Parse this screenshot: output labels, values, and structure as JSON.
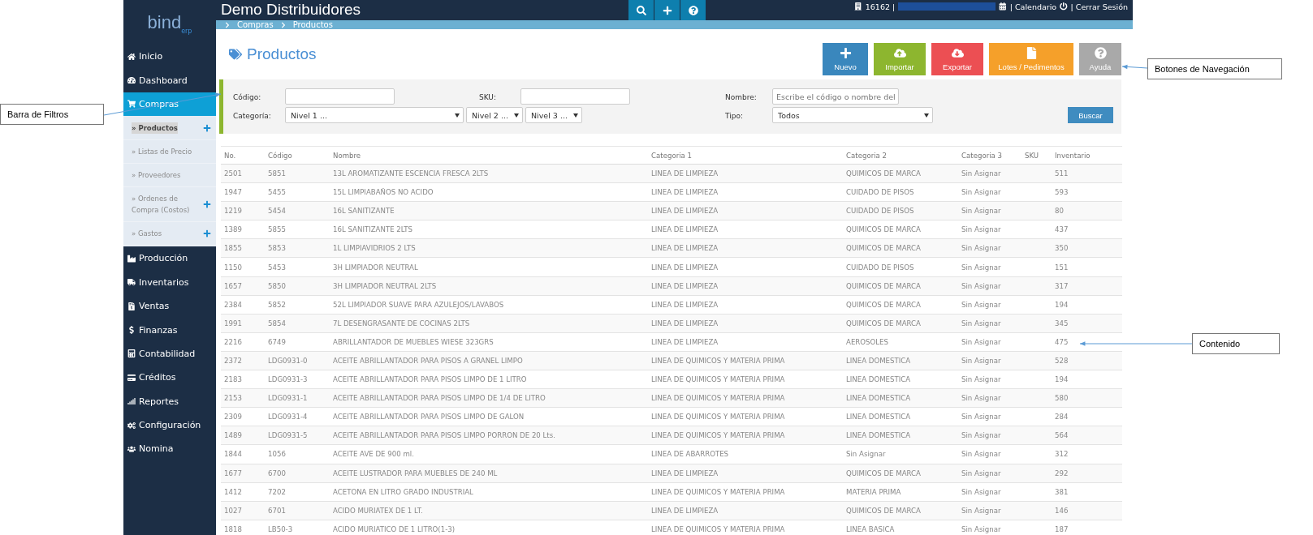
{
  "header": {
    "title": "Demo Distribuidores",
    "company_id": "16162 |",
    "links": [
      "| Calendario",
      "| Cerrar Sesión"
    ]
  },
  "logo": {
    "name": "bind",
    "sub": "erp"
  },
  "breadcrumb": [
    "Compras",
    "Productos"
  ],
  "sidebar": {
    "items": [
      {
        "label": "Inicio",
        "selected": false
      },
      {
        "label": "Dashboard",
        "selected": false
      },
      {
        "label": "Compras",
        "selected": true,
        "children": [
          {
            "label": "» Productos",
            "selected": true,
            "add_button": true
          },
          {
            "label": "» Listas de Precio",
            "selected": false,
            "add_button": false
          },
          {
            "label": "» Proveedores",
            "selected": false,
            "add_button": false
          },
          {
            "label": "» Ordenes de Compra (Costos)",
            "selected": false,
            "add_button": true
          },
          {
            "label": "» Gastos",
            "selected": false,
            "add_button": true
          }
        ]
      },
      {
        "label": "Producción",
        "selected": false
      },
      {
        "label": "Inventarios",
        "selected": false
      },
      {
        "label": "Ventas",
        "selected": false
      },
      {
        "label": "Finanzas",
        "selected": false
      },
      {
        "label": "Contabilidad",
        "selected": false
      },
      {
        "label": "Créditos",
        "selected": false
      },
      {
        "label": "Reportes",
        "selected": false
      },
      {
        "label": "Configuración",
        "selected": false
      },
      {
        "label": "Nomina",
        "selected": false
      }
    ]
  },
  "page_title": "Productos",
  "actions": [
    {
      "label": "Nuevo",
      "color": "#3a87bd"
    },
    {
      "label": "Importar",
      "color": "#8db62f"
    },
    {
      "label": "Exportar",
      "color": "#ec4f53"
    },
    {
      "label": "Lotes / Pedimentos",
      "color": "#f5a02a"
    },
    {
      "label": "Ayuda",
      "color": "#a9a9a9"
    }
  ],
  "filters": {
    "code_label": "Código:",
    "sku_label": "SKU:",
    "name_label": "Nombre:",
    "name_placeholder": "Escribe el código o nombre del",
    "category_label": "Categoría:",
    "levels": [
      "Nivel 1 ...",
      "Nivel 2 ...",
      "Nivel 3 ..."
    ],
    "type_label": "Tipo:",
    "type_value": "Todos",
    "search_button": "Buscar"
  },
  "table": {
    "columns": [
      "No.",
      "Código",
      "Nombre",
      "Categoria 1",
      "Categoria 2",
      "Categoria 3",
      "SKU",
      "Inventario"
    ],
    "rows": [
      [
        "2501",
        "5851",
        "13L AROMATIZANTE ESCENCIA FRESCA 2LTS",
        "LINEA DE LIMPIEZA",
        "QUIMICOS DE MARCA",
        "Sin Asignar",
        "",
        "511"
      ],
      [
        "1947",
        "5455",
        "15L LIMPIABAÑOS NO ACIDO",
        "LINEA DE LIMPIEZA",
        "CUIDADO DE PISOS",
        "Sin Asignar",
        "",
        "593"
      ],
      [
        "1219",
        "5454",
        "16L SANITIZANTE",
        "LINEA DE LIMPIEZA",
        "CUIDADO DE PISOS",
        "Sin Asignar",
        "",
        "80"
      ],
      [
        "1389",
        "5855",
        "16L SANITIZANTE 2LTS",
        "LINEA DE LIMPIEZA",
        "QUIMICOS DE MARCA",
        "Sin Asignar",
        "",
        "437"
      ],
      [
        "1855",
        "5853",
        "1L LIMPIAVIDRIOS 2 LTS",
        "LINEA DE LIMPIEZA",
        "QUIMICOS DE MARCA",
        "Sin Asignar",
        "",
        "350"
      ],
      [
        "1150",
        "5453",
        "3H LIMPIADOR NEUTRAL",
        "LINEA DE LIMPIEZA",
        "CUIDADO DE PISOS",
        "Sin Asignar",
        "",
        "151"
      ],
      [
        "1657",
        "5850",
        "3H LIMPIADOR NEUTRAL 2LTS",
        "LINEA DE LIMPIEZA",
        "QUIMICOS DE MARCA",
        "Sin Asignar",
        "",
        "317"
      ],
      [
        "2384",
        "5852",
        "52L LIMPIADOR SUAVE PARA AZULEJOS/LAVABOS",
        "LINEA DE LIMPIEZA",
        "QUIMICOS DE MARCA",
        "Sin Asignar",
        "",
        "194"
      ],
      [
        "1991",
        "5854",
        "7L DESENGRASANTE DE COCINAS 2LTS",
        "LINEA DE LIMPIEZA",
        "QUIMICOS DE MARCA",
        "Sin Asignar",
        "",
        "345"
      ],
      [
        "2216",
        "6749",
        "ABRILLANTADOR DE MUEBLES WIESE 323GRS",
        "LINEA DE LIMPIEZA",
        "AEROSOLES",
        "Sin Asignar",
        "",
        "475"
      ],
      [
        "2372",
        "LDG0931-0",
        "ACEITE ABRILLANTADOR PARA PISOS A GRANEL LIMPO",
        "LINEA DE QUIMICOS Y MATERIA PRIMA",
        "LINEA DOMESTICA",
        "Sin Asignar",
        "",
        "528"
      ],
      [
        "2183",
        "LDG0931-3",
        "ACEITE ABRILLANTADOR PARA PISOS LIMPO DE 1 LITRO",
        "LINEA DE QUIMICOS Y MATERIA PRIMA",
        "LINEA DOMESTICA",
        "Sin Asignar",
        "",
        "194"
      ],
      [
        "2153",
        "LDG0931-1",
        "ACEITE ABRILLANTADOR PARA PISOS LIMPO DE 1/4 DE LITRO",
        "LINEA DE QUIMICOS Y MATERIA PRIMA",
        "LINEA DOMESTICA",
        "Sin Asignar",
        "",
        "580"
      ],
      [
        "2309",
        "LDG0931-4",
        "ACEITE ABRILLANTADOR PARA PISOS LIMPO DE GALON",
        "LINEA DE QUIMICOS Y MATERIA PRIMA",
        "LINEA DOMESTICA",
        "Sin Asignar",
        "",
        "284"
      ],
      [
        "1489",
        "LDG0931-5",
        "ACEITE ABRILLANTADOR PARA PISOS LIMPO PORRON DE 20 Lts.",
        "LINEA DE QUIMICOS Y MATERIA PRIMA",
        "LINEA DOMESTICA",
        "Sin Asignar",
        "",
        "564"
      ],
      [
        "1844",
        "1056",
        "ACEITE AVE DE 900 ml.",
        "LINEA DE ABARROTES",
        "Sin Asignar",
        "Sin Asignar",
        "",
        "312"
      ],
      [
        "1677",
        "6700",
        "ACEITE LUSTRADOR PARA MUEBLES DE 240 ML",
        "LINEA DE LIMPIEZA",
        "QUIMICOS DE MARCA",
        "Sin Asignar",
        "",
        "292"
      ],
      [
        "1412",
        "7202",
        "ACETONA EN LITRO GRADO INDUSTRIAL",
        "LINEA DE QUIMICOS Y MATERIA PRIMA",
        "MATERIA PRIMA",
        "Sin Asignar",
        "",
        "381"
      ],
      [
        "1027",
        "6701",
        "ACIDO MURIATEX DE 1 LT.",
        "LINEA DE LIMPIEZA",
        "QUIMICOS DE MARCA",
        "Sin Asignar",
        "",
        "146"
      ],
      [
        "1818",
        "LB50-3",
        "ACIDO MURIATICO DE 1 LITRO(1-3)",
        "LINEA DE QUIMICOS Y MATERIA PRIMA",
        "LINEA BASICA",
        "Sin Asignar",
        "",
        "187"
      ]
    ]
  },
  "annotations": [
    "Barra de Filtros",
    "Botones de Navegación",
    "Contenido"
  ]
}
